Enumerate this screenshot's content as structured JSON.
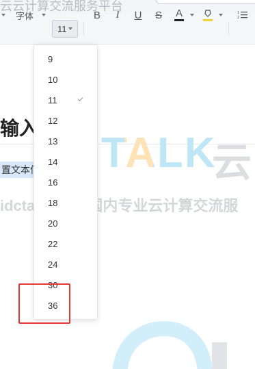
{
  "topstrip": {
    "text": "云云计算交流服务平台"
  },
  "toolbar": {
    "font_label": "字体",
    "size_value": "11",
    "bold": "B",
    "italic": "I",
    "underline": "U",
    "strike": "S",
    "color": "A"
  },
  "document": {
    "heading": "输入标",
    "highlight": "置文本信"
  },
  "watermark": {
    "logo": "TALK",
    "yun": "云",
    "line": "idctalk.com-国内专业云计算交流服"
  },
  "dropdown": {
    "options": [
      "9",
      "10",
      "11",
      "12",
      "13",
      "14",
      "16",
      "18",
      "20",
      "22",
      "24",
      "30",
      "36"
    ],
    "selected": "11"
  },
  "colors": {
    "accent": "#e53935",
    "logo_blue": "#bfe6f7",
    "logo_yellow": "#ffe7bf"
  }
}
